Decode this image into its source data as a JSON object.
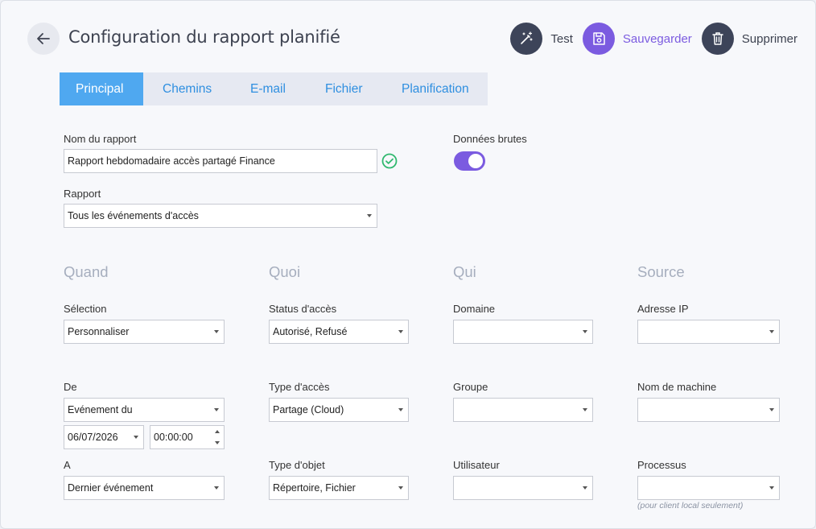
{
  "header": {
    "title": "Configuration du rapport planifié",
    "actions": {
      "test": "Test",
      "save": "Sauvegarder",
      "delete": "Supprimer"
    }
  },
  "tabs": [
    "Principal",
    "Chemins",
    "E-mail",
    "Fichier",
    "Planification"
  ],
  "active_tab": "Principal",
  "report": {
    "name_label": "Nom du rapport",
    "name_value": "Rapport hebdomadaire accès partagé Finance",
    "raw_label": "Données brutes",
    "raw_enabled": true,
    "report_label": "Rapport",
    "report_value": "Tous les événements d'accès"
  },
  "sections": {
    "when": "Quand",
    "what": "Quoi",
    "who": "Qui",
    "source": "Source"
  },
  "when": {
    "selection_label": "Sélection",
    "selection_value": "Personnaliser",
    "from_label": "De",
    "from_value": "Evénement du",
    "from_date": "06/07/2026",
    "from_time": "00:00:00",
    "to_label": "A",
    "to_value": "Dernier événement"
  },
  "what": {
    "status_label": "Status d'accès",
    "status_value": "Autorisé, Refusé",
    "type_label": "Type d'accès",
    "type_value": "Partage (Cloud)",
    "object_label": "Type d'objet",
    "object_value": "Répertoire, Fichier"
  },
  "who": {
    "domain_label": "Domaine",
    "domain_value": "",
    "group_label": "Groupe",
    "group_value": "",
    "user_label": "Utilisateur",
    "user_value": ""
  },
  "source": {
    "ip_label": "Adresse IP",
    "ip_value": "",
    "machine_label": "Nom de machine",
    "machine_value": "",
    "process_label": "Processus",
    "process_value": "",
    "process_note": "(pour client local seulement)"
  },
  "colors": {
    "accent": "#7b5be0",
    "tab_active": "#4fa8f0",
    "tab_text": "#2f8fe0",
    "dark_button": "#3d4459",
    "success": "#2fb86e"
  }
}
